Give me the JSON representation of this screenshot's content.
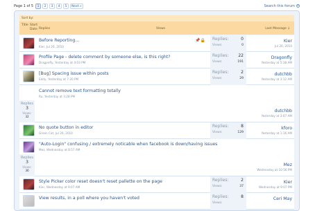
{
  "pagination": {
    "label": "Page 1 of 5",
    "pages": [
      "1",
      "2",
      "3",
      "4",
      "5"
    ],
    "next": "Next »"
  },
  "search_forum": "Search this forum",
  "sort_label": "Sort by:",
  "columns": {
    "title": "Title",
    "start_date": "Start Date",
    "replies": "Replies",
    "views": "Views",
    "last_message": "Last Message ↓"
  },
  "threads": [
    {
      "title": "Before Reporting...",
      "meta": "Kier, Jul 20, 2010",
      "replies_label": "Replies:",
      "replies": "0",
      "views_label": "Views:",
      "views": "0",
      "last_user": "Kier",
      "last_date": "Jul 20, 2010",
      "icons": "📌🔒"
    },
    {
      "title": "Profile Page - delete comment by someone else, is this right?",
      "meta": "Dragonfly, Yesterday at 4:03 PM",
      "replies_label": "Replies:",
      "replies": "22",
      "views_label": "Views:",
      "views": "191",
      "last_user": "Dragonfly",
      "last_date": "Yesterday at 5:38 AM"
    },
    {
      "title": "[Bug] Spacing issue within posts",
      "meta": "Eddy, Yesterday at 7:20 PM",
      "replies_label": "Replies:",
      "replies": "2",
      "views_label": "Views:",
      "views": "29",
      "last_user": "dutchbb",
      "last_date": "Yesterday at 3:12 AM"
    },
    {
      "title": "Cannot remove text formatting totally",
      "meta": "Ru, Yesterday at 3:28 PM",
      "replies_label": "Replies",
      "replies": "3",
      "views_label": "Views:",
      "views": "32",
      "last_user": "dutchbb",
      "last_date": "Yesterday at 3:07 AM"
    },
    {
      "title": "No quote button in editor",
      "meta": "Green Cat, Jul 20, 2010",
      "replies_label": "Replies:",
      "replies": "8",
      "views_label": "Views:",
      "views": "129",
      "last_user": "kforo",
      "last_date": "Yesterday at 1:16 AM"
    },
    {
      "title": "\"Auto-Login\" confusing / extremely noticable when facebook is down/having issues",
      "meta": "Mez, Wednesday at 8:57 AM",
      "replies_label": "Replies",
      "replies": "3",
      "views_label": "Views:",
      "views": "36",
      "last_user": "Mez",
      "last_date": "Wednesday at 10:56 PM"
    },
    {
      "title": "Style Picker color reset doesn't reset pallette on the page",
      "meta": "Kier, Wednesday at 9:07 AM",
      "replies_label": "Replies:",
      "replies": "2",
      "views_label": "Views:",
      "views": "37",
      "last_user": "Kier",
      "last_date": "Wednesday at 9:07 PM"
    },
    {
      "title": "View results, in a poll where you haven't voted",
      "meta": "",
      "replies_label": "Replies:",
      "replies": "8",
      "views_label": "Views:",
      "views": "",
      "last_user": "Ceri May",
      "last_date": ""
    }
  ]
}
